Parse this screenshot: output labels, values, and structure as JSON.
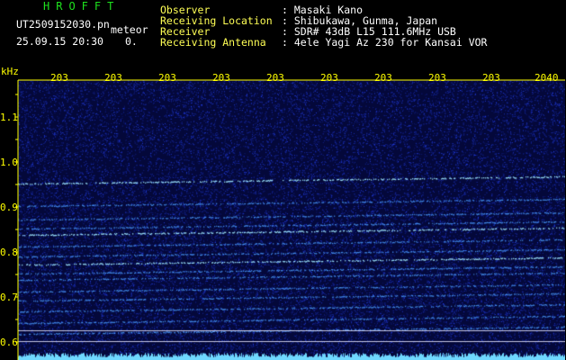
{
  "header": {
    "logo": "HROFFT",
    "filename": "UT2509152030.pn",
    "tag": "meteor",
    "datetime": "25.09.15 20:30",
    "count": "0.",
    "fields": [
      {
        "label": "Observer",
        "value": ": Masaki Kano"
      },
      {
        "label": "Receiving Location",
        "value": ": Shibukawa, Gunma, Japan"
      },
      {
        "label": "Receiver",
        "value": ": SDR# 43dB L15 111.6MHz USB"
      },
      {
        "label": "Receiving Antenna",
        "value": ": 4ele Yagi Az 230 for Kansai VOR"
      }
    ]
  },
  "spectrogram": {
    "freq_unit": "kHz",
    "freq_ticks": [
      "1.1",
      "1.0",
      "0.9",
      "0.8",
      "0.7",
      "0.6"
    ],
    "time_ticks": [
      "203",
      "203",
      "203",
      "203",
      "203",
      "203",
      "203",
      "203",
      "203",
      "2040"
    ],
    "colors": {
      "background": "#04083a",
      "noise": "#1a3cff",
      "line": "#4a9cff",
      "bright": "#9fe8ff",
      "tick": "#ffff00"
    }
  }
}
